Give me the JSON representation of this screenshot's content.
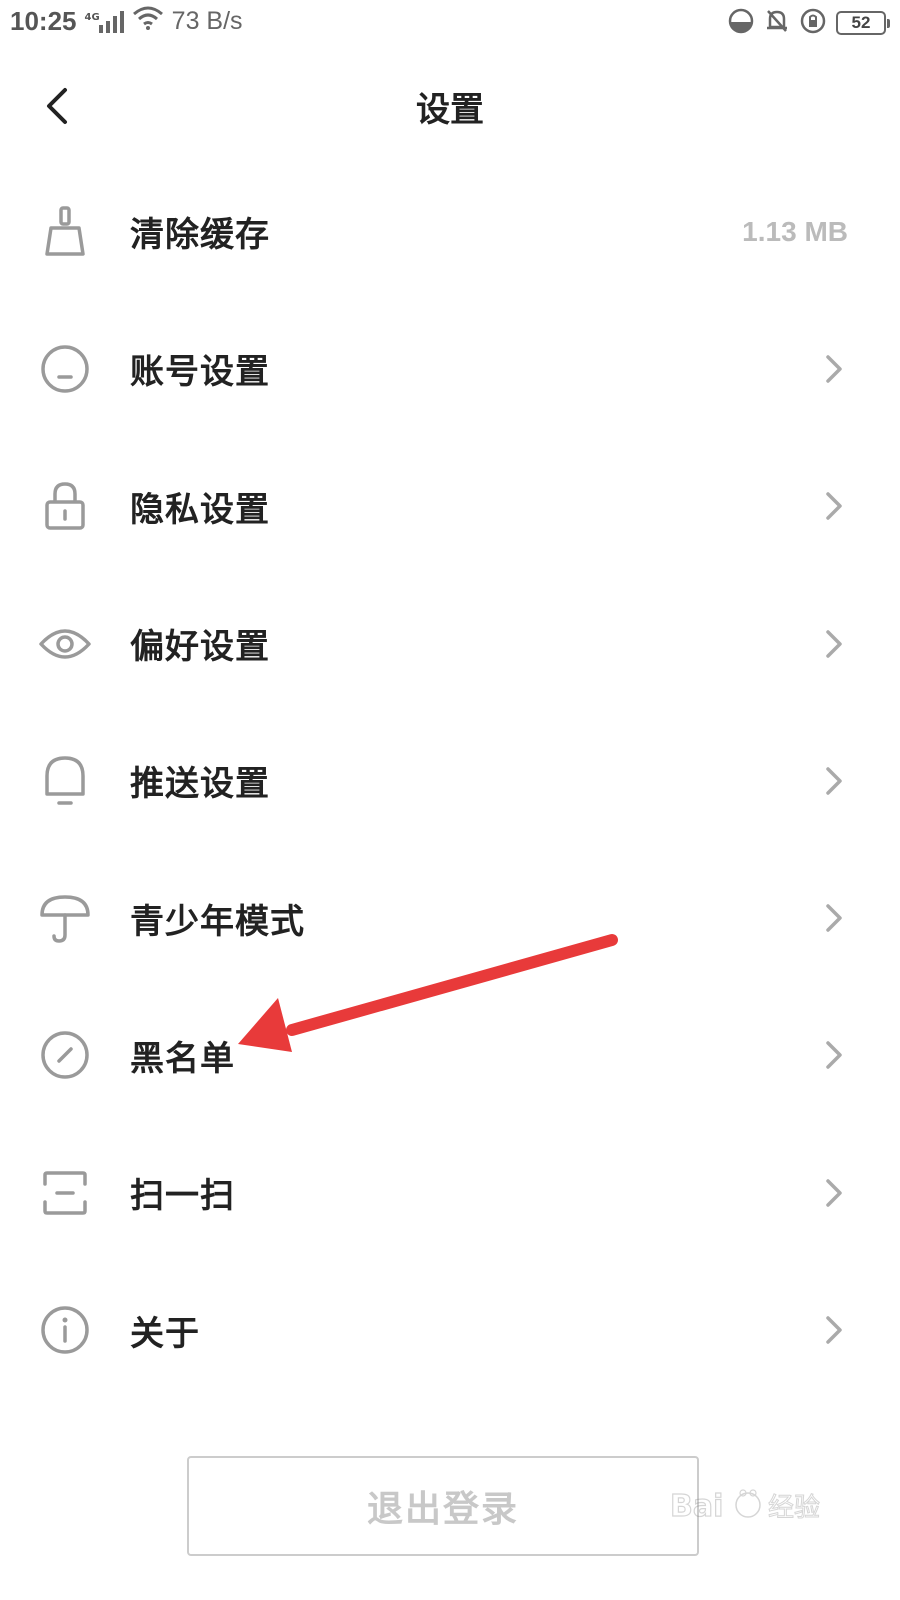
{
  "status_bar": {
    "time": "10:25",
    "network": "4G",
    "speed": "73 B/s",
    "battery": "52"
  },
  "header": {
    "title": "设置"
  },
  "menu": {
    "items": [
      {
        "label": "清除缓存",
        "value": "1.13 MB",
        "icon": "broom-icon"
      },
      {
        "label": "账号设置",
        "icon": "account-icon"
      },
      {
        "label": "隐私设置",
        "icon": "lock-icon"
      },
      {
        "label": "偏好设置",
        "icon": "eye-icon"
      },
      {
        "label": "推送设置",
        "icon": "bell-icon"
      },
      {
        "label": "青少年模式",
        "icon": "umbrella-icon"
      },
      {
        "label": "黑名单",
        "icon": "block-icon"
      },
      {
        "label": "扫一扫",
        "icon": "scan-icon"
      },
      {
        "label": "关于",
        "icon": "info-icon"
      }
    ]
  },
  "logout": {
    "label": "退出登录"
  },
  "watermark": {
    "text": "Bai 经验",
    "url": "jingyan.baidu.com"
  },
  "colors": {
    "text": "#222222",
    "icon": "#9a9a9a",
    "muted": "#bbbbbb",
    "annotation_arrow": "#e83a3a"
  }
}
